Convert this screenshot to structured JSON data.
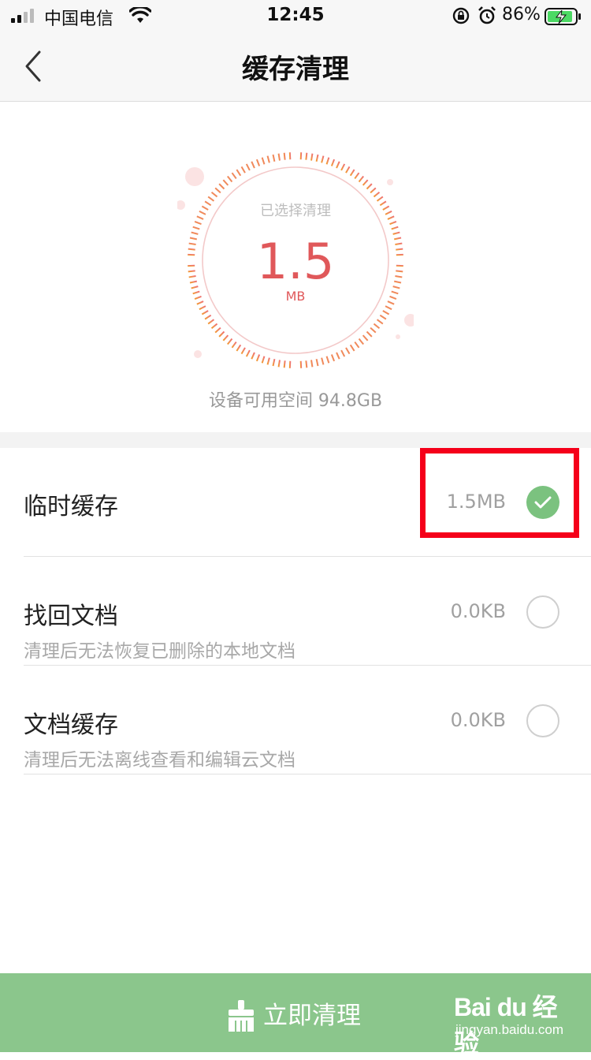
{
  "status_bar": {
    "carrier": "中国电信",
    "time": "12:45",
    "battery_percent": "86%"
  },
  "nav": {
    "title": "缓存清理"
  },
  "gauge": {
    "caption": "已选择清理",
    "value": "1.5",
    "unit": "MB"
  },
  "storage": {
    "available_text": "设备可用空间 94.8GB"
  },
  "cache_items": [
    {
      "title": "临时缓存",
      "subtitle": "",
      "size": "1.5MB",
      "checked": true
    },
    {
      "title": "找回文档",
      "subtitle": "清理后无法恢复已删除的本地文档",
      "size": "0.0KB",
      "checked": false
    },
    {
      "title": "文档缓存",
      "subtitle": "清理后无法离线查看和编辑云文档",
      "size": "0.0KB",
      "checked": false
    }
  ],
  "action": {
    "label": "立即清理"
  },
  "watermark": {
    "main": "Bai du 经验",
    "sub": "jingyan.baidu.com"
  },
  "colors": {
    "accent_green": "#8bc68c",
    "check_green": "#7bc27f",
    "gauge_red": "#e0585a",
    "highlight_red": "#f5001a"
  }
}
